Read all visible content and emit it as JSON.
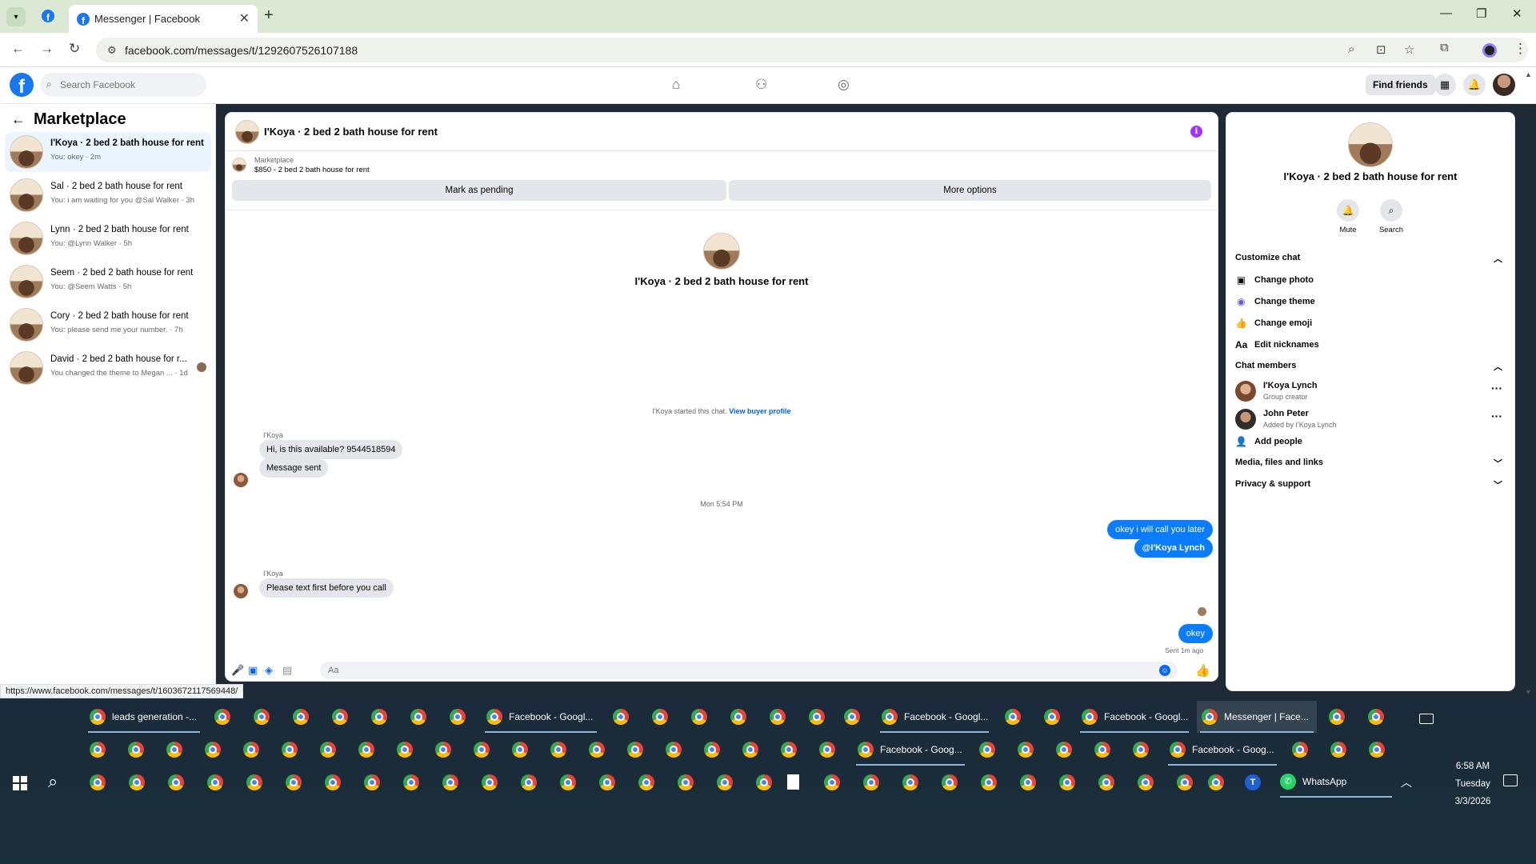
{
  "browser": {
    "tab_title": "Messenger | Facebook",
    "url": "facebook.com/messages/t/1292607526107188",
    "status_url": "https://www.facebook.com/messages/t/1603672117569448/"
  },
  "fb": {
    "search_placeholder": "Search Facebook",
    "find_friends": "Find friends"
  },
  "sidebar": {
    "title": "Marketplace",
    "conversations": [
      {
        "name": "I'Koya · 2 bed 2 bath house for rent",
        "snippet": "You: okey · 2m"
      },
      {
        "name": "Sal · 2 bed 2 bath house for rent",
        "snippet": "You: i am waiting for you @Sal Walker · 3h"
      },
      {
        "name": "Lynn · 2 bed 2 bath house for rent",
        "snippet": "You: @Lynn Walker · 5h"
      },
      {
        "name": "Seem · 2 bed 2 bath house for rent",
        "snippet": "You: @Seem Watts · 5h"
      },
      {
        "name": "Cory · 2 bed 2 bath house for rent",
        "snippet": "You: please send me your number. · 7h"
      },
      {
        "name": "David · 2 bed 2 bath house for r...",
        "snippet": "You changed the theme to Megan ... · 1d"
      }
    ]
  },
  "chat": {
    "title": "I'Koya · 2 bed 2 bath house for rent",
    "listing_source": "Marketplace",
    "listing_price": "$850 - 2 bed 2 bath house for rent",
    "mark_pending": "Mark as pending",
    "more_options": "More options",
    "intro_name": "I'Koya · 2 bed 2 bath house for rent",
    "started_text": "I'Koya started this chat.",
    "view_buyer": "View buyer profile",
    "sender1": "I'Koya",
    "msg1": "Hi, is this available? 9544518594",
    "msg2": "Message sent",
    "timestamp": "Mon 5:54 PM",
    "out1": "okey i will call you later",
    "out2": "@I'Koya Lynch",
    "sender2": "I'Koya",
    "msg3": "Please text first before you call",
    "out3": "okey",
    "sent_label": "Sent 1m ago",
    "composer_placeholder": "Aa"
  },
  "panel": {
    "name": "I'Koya · 2 bed 2 bath house for rent",
    "mute": "Mute",
    "search": "Search",
    "customize": "Customize chat",
    "change_photo": "Change photo",
    "change_theme": "Change theme",
    "change_emoji": "Change emoji",
    "edit_nicknames": "Edit nicknames",
    "nick_icon": "Aa",
    "chat_members": "Chat members",
    "members": [
      {
        "name": "I'Koya Lynch",
        "sub": "Group creator"
      },
      {
        "name": "John Peter",
        "sub": "Added by I'Koya Lynch"
      }
    ],
    "add_people": "Add people",
    "media": "Media, files and links",
    "privacy": "Privacy & support"
  },
  "taskbar": {
    "row1_apps": [
      "leads generation -...",
      "Facebook - Googl...",
      "Facebook - Googl...",
      "Facebook - Googl...",
      "Messenger | Face..."
    ],
    "row2_apps": [
      "Facebook - Goog...",
      "Facebook - Goog..."
    ],
    "whatsapp": "WhatsApp",
    "t_label": "T",
    "time": "6:58 AM",
    "day": "Tuesday",
    "date": "3/3/2026"
  },
  "colors": {
    "fb_blue": "#1877f2",
    "bubble_out": "#0a7cff",
    "info_purple": "#a033ff"
  }
}
